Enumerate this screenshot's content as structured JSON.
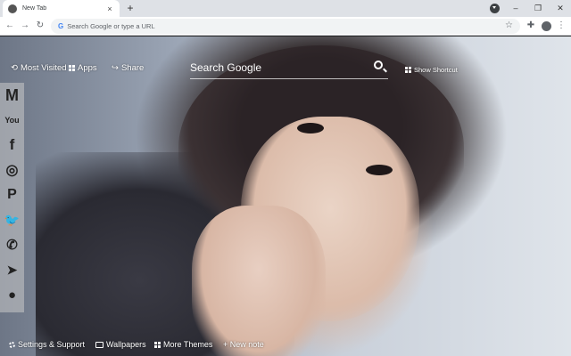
{
  "browser": {
    "tab_title": "New Tab",
    "tab_close": "×",
    "new_tab": "+",
    "window_controls": [
      "–",
      "❐",
      "✕"
    ],
    "omnibox_placeholder": "Search Google or type a URL",
    "nav": {
      "back": "←",
      "forward": "→",
      "reload": "↻"
    },
    "bookmark_star": "☆",
    "extensions_icon": "puzzle-icon",
    "menu": "⋮"
  },
  "newtab": {
    "most_visited": "Most Visited",
    "apps": "Apps",
    "share": "Share",
    "search_placeholder": "Search Google",
    "show_shortcut": "Show Shortcut"
  },
  "social": [
    {
      "name": "gmail-icon",
      "glyph": "M"
    },
    {
      "name": "youtube-icon",
      "glyph": "You"
    },
    {
      "name": "facebook-icon",
      "glyph": "f"
    },
    {
      "name": "instagram-icon",
      "glyph": "◎"
    },
    {
      "name": "pinterest-icon",
      "glyph": "P"
    },
    {
      "name": "twitter-icon",
      "glyph": "🐦"
    },
    {
      "name": "whatsapp-icon",
      "glyph": "✆"
    },
    {
      "name": "telegram-icon",
      "glyph": "➤"
    },
    {
      "name": "reddit-icon",
      "glyph": "●"
    }
  ],
  "footer": {
    "settings": "Settings & Support",
    "wallpapers": "Wallpapers",
    "more_themes": "More Themes",
    "new_note": "+ New note"
  }
}
